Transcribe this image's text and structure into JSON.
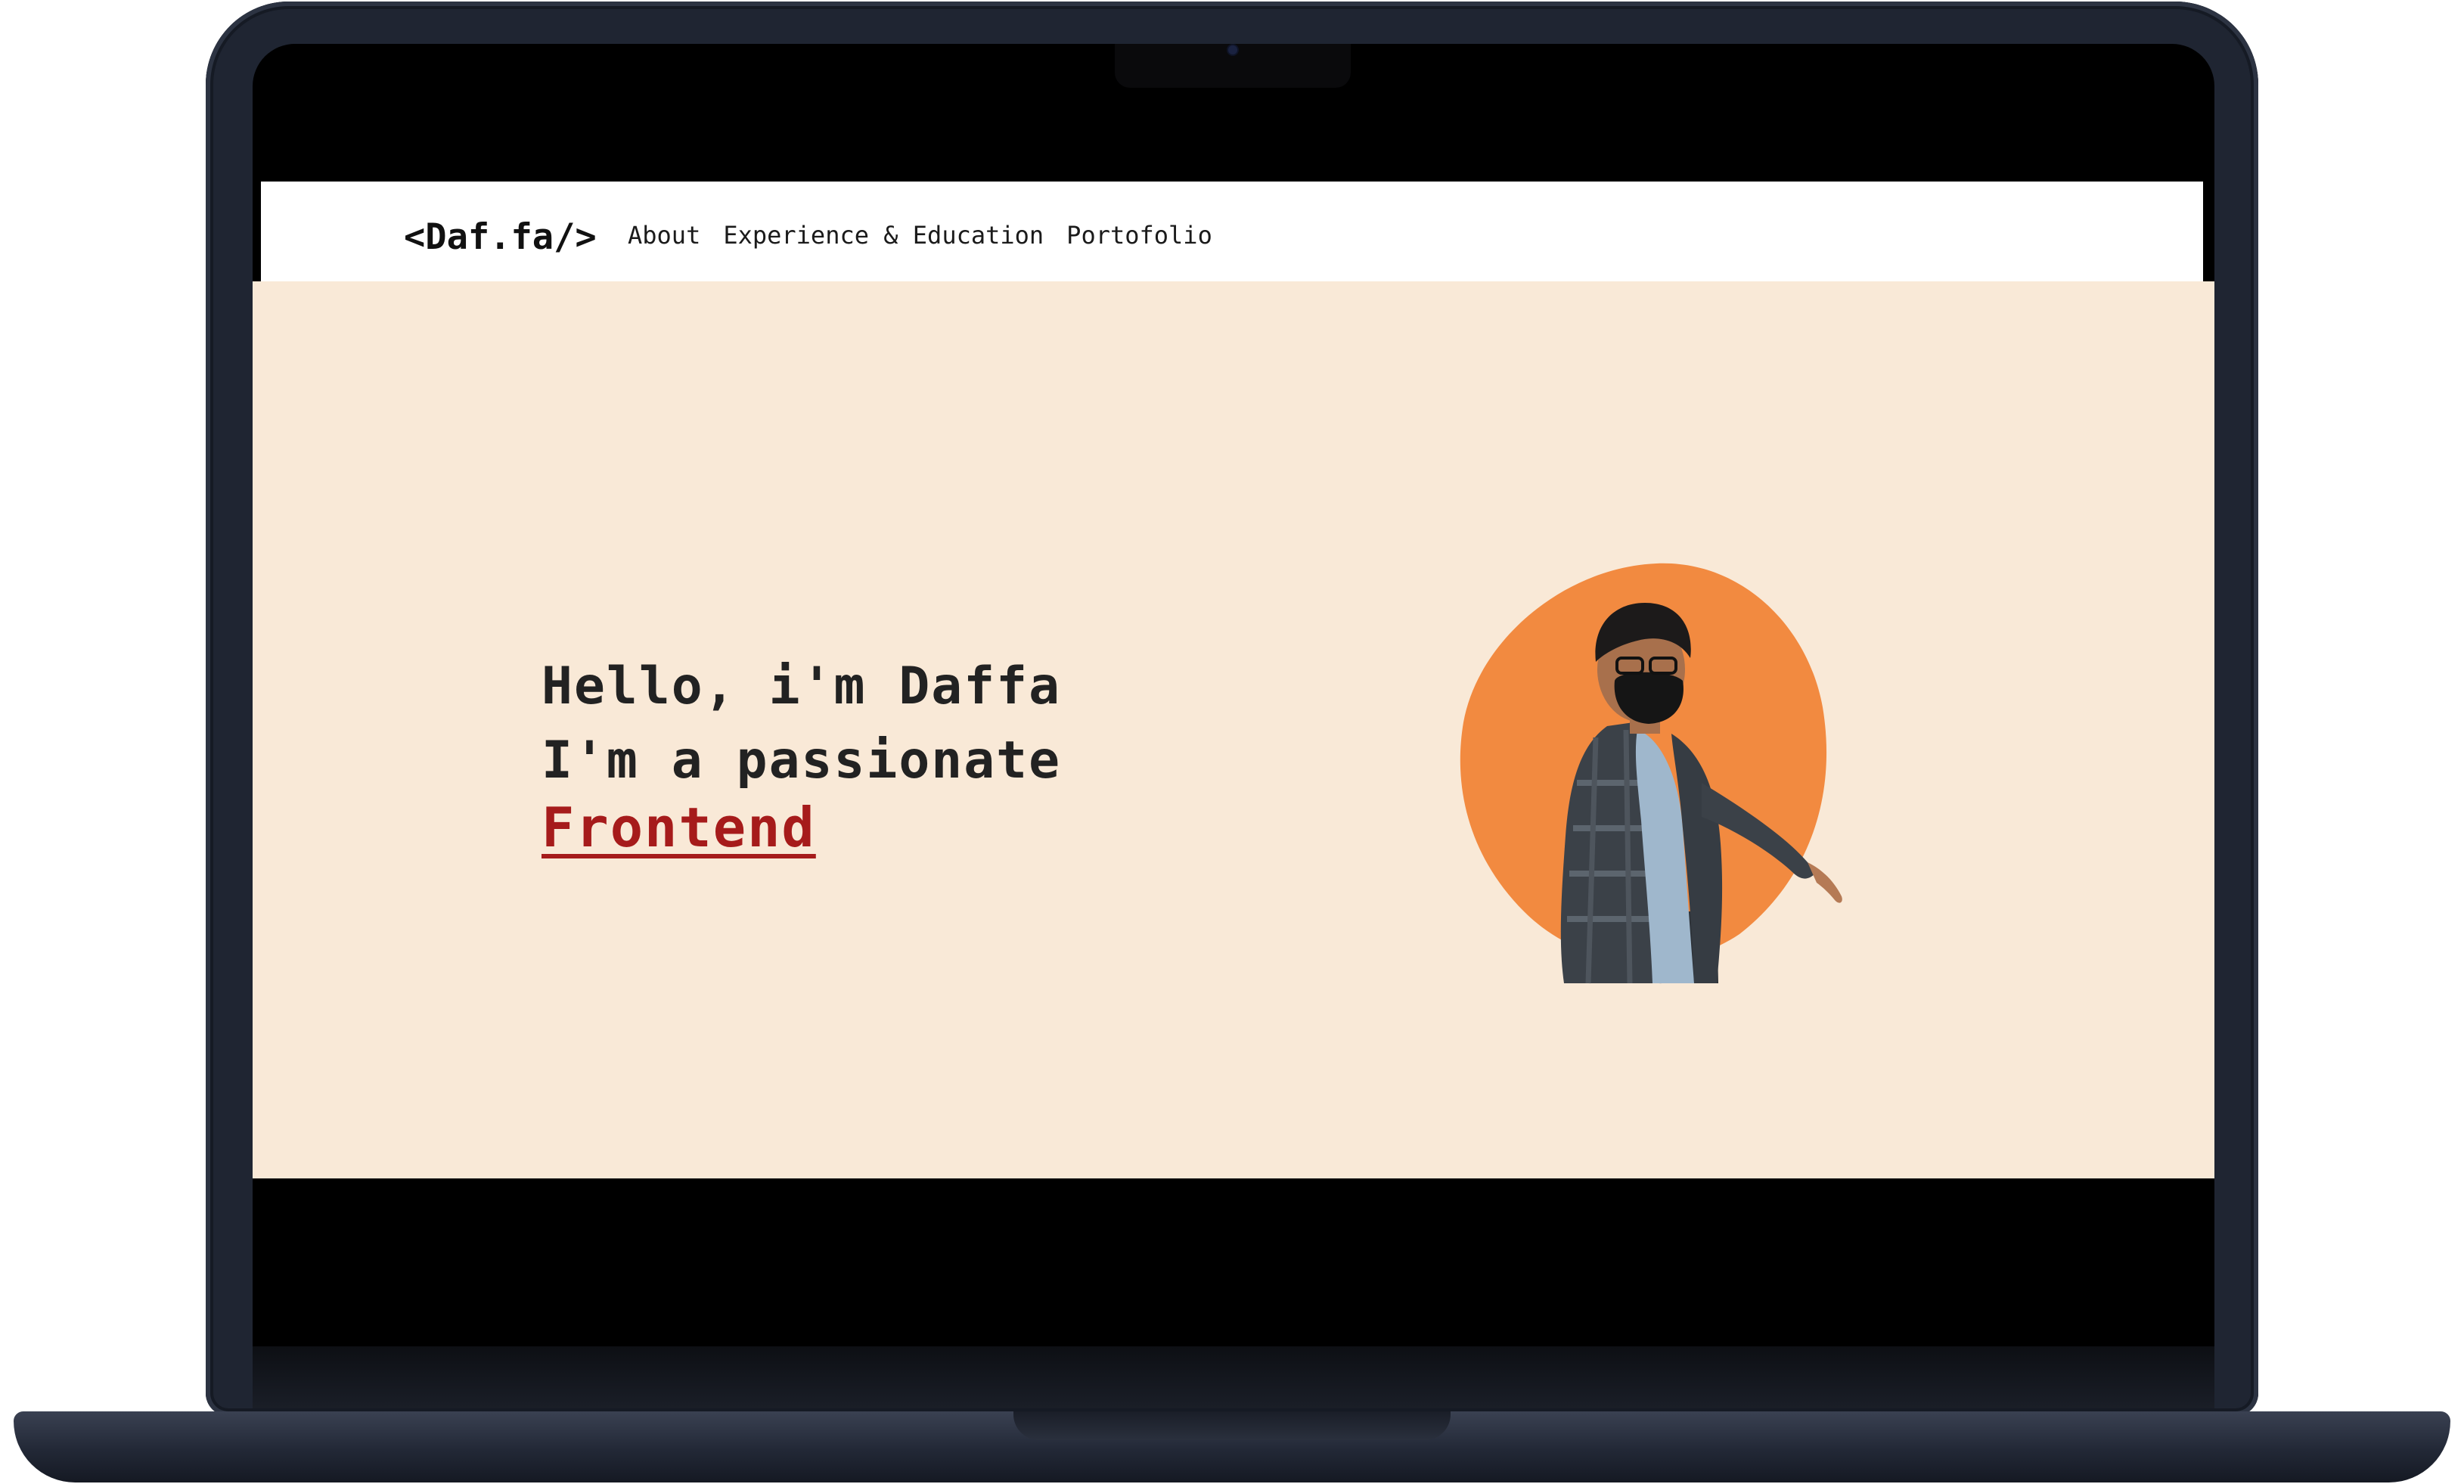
{
  "navbar": {
    "logo": "<Daf.fa/>",
    "links": [
      {
        "label": "About"
      },
      {
        "label": "Experience & Education"
      },
      {
        "label": "Portofolio"
      }
    ]
  },
  "hero": {
    "greeting": "Hello, i'm Daffa",
    "tagline": "I'm a passionate",
    "role": "Frontend"
  },
  "colors": {
    "hero_background": "#f9e9d7",
    "accent_red": "#a61b1b",
    "photo_blob": "#f28a40",
    "laptop_body": "#1f2532"
  },
  "icons": {
    "camera": "camera-dot-icon"
  }
}
